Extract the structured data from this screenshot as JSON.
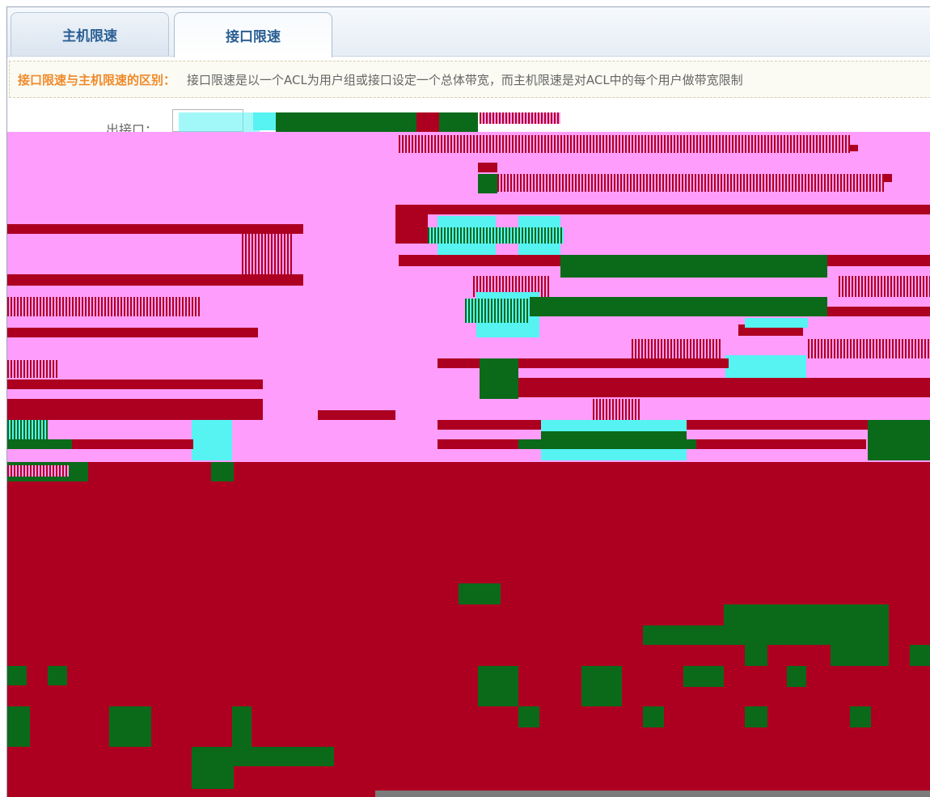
{
  "tabs": [
    {
      "label": "主机限速",
      "active": false
    },
    {
      "label": "接口限速",
      "active": true
    }
  ],
  "notice": {
    "title": "接口限速与主机限速的区别：",
    "text": "接口限速是以一个ACL为用户组或接口设定一个总体带宽，而主机限速是对ACL中的每个用户做带宽限制"
  },
  "form": {
    "out_interface_label": "出接口：",
    "out_interface_value": ""
  },
  "colors": {
    "accent": "#2a5f94",
    "notice_title": "#f08a2a",
    "glitch_pink": "#ff9dfc",
    "glitch_red": "#ad0021",
    "glitch_green": "#0a6a19",
    "glitch_cyan": "#56f3f2"
  }
}
